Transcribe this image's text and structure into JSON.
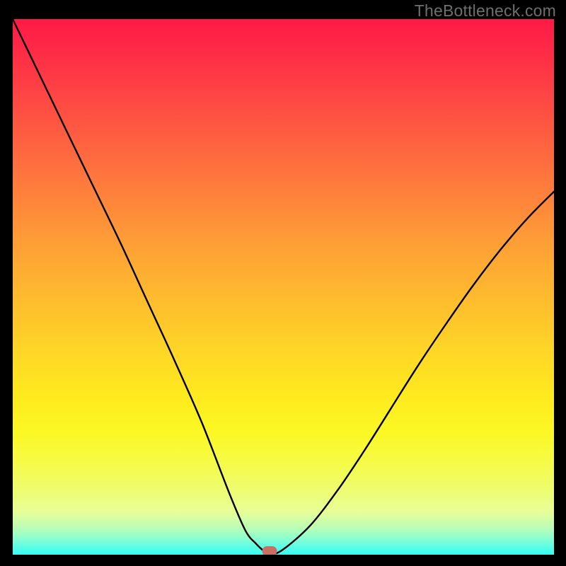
{
  "watermark_text": "TheBottleneck.com",
  "chart_data": {
    "type": "line",
    "title": "",
    "xlabel": "",
    "ylabel": "",
    "xlim": [
      0,
      1
    ],
    "ylim": [
      0,
      1
    ],
    "background_gradient": {
      "top_color": "#fe1a46",
      "mid_color": "#fee91e",
      "bottom_color": "#34fef4"
    },
    "series": [
      {
        "name": "bottleneck-curve",
        "color": "#000000",
        "x": [
          0.0,
          0.05,
          0.1,
          0.15,
          0.2,
          0.25,
          0.3,
          0.35,
          0.4,
          0.43,
          0.45,
          0.465,
          0.475,
          0.5,
          0.55,
          0.6,
          0.65,
          0.7,
          0.75,
          0.8,
          0.85,
          0.9,
          0.95,
          1.0
        ],
        "y": [
          1.0,
          0.895,
          0.79,
          0.685,
          0.58,
          0.47,
          0.36,
          0.245,
          0.115,
          0.045,
          0.02,
          0.006,
          0.0,
          0.01,
          0.055,
          0.12,
          0.195,
          0.275,
          0.355,
          0.43,
          0.502,
          0.568,
          0.627,
          0.678
        ]
      }
    ],
    "marker": {
      "x": 0.475,
      "y": 0.007,
      "color": "#cb6e64"
    }
  }
}
